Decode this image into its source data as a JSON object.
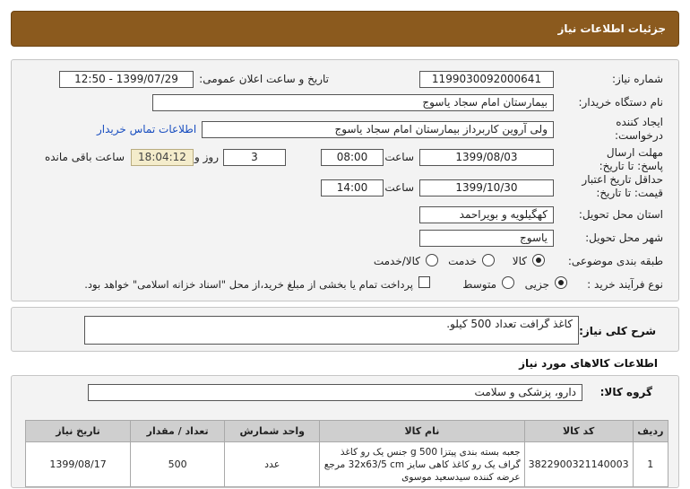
{
  "header": {
    "title": "جزئیات اطلاعات نیاز"
  },
  "form": {
    "need_number_label": "شماره نیاز:",
    "need_number": "1199030092000641",
    "announce_label": "تاریخ و ساعت اعلان عمومی:",
    "announce_value": "1399/07/29 - 12:50",
    "buyer_label": "نام دستگاه خریدار:",
    "buyer_value": "بیمارستان امام سجاد یاسوج",
    "requester_label": "ایجاد کننده درخواست:",
    "requester_value": "ولی آروین کاربرداز بیمارستان امام سجاد یاسوج",
    "contact_link": "اطلاعات تماس خریدار",
    "deadline_label": "مهلت ارسال پاسخ: تا تاریخ:",
    "deadline_date": "1399/08/03",
    "time_label": "ساعت",
    "deadline_time": "08:00",
    "days_value": "3",
    "days_label": "روز و",
    "timer_value": "18:04:12",
    "remaining_label": "ساعت باقی مانده",
    "validity_label": "حداقل تاریخ اعتبار قیمت: تا تاریخ:",
    "validity_date": "1399/10/30",
    "validity_time": "14:00",
    "province_label": "استان محل تحویل:",
    "province_value": "کهگیلویه و بویراحمد",
    "city_label": "شهر محل تحویل:",
    "city_value": "یاسوج",
    "category_label": "طبقه بندی موضوعی:",
    "category_options": [
      "کالا",
      "خدمت",
      "کالا/خدمت"
    ],
    "category_selected": "کالا",
    "process_label": "نوع فرآیند خرید :",
    "process_options": [
      "جزیی",
      "متوسط"
    ],
    "process_selected": "جزیی",
    "payment_note": "پرداخت تمام یا بخشی از مبلغ خرید،از محل \"اسناد خزانه اسلامی\" خواهد بود."
  },
  "summary": {
    "label": "شرح کلی نیاز:",
    "value": "کاغذ گرافت تعداد 500 کیلو."
  },
  "goods_section": {
    "title": "اطلاعات کالاهای مورد نیاز",
    "group_label": "گروه کالا:",
    "group_value": "دارو، پزشکی و سلامت"
  },
  "table": {
    "headers": [
      "ردیف",
      "کد کالا",
      "نام کالا",
      "واحد شمارش",
      "تعداد / مقدار",
      "تاریخ نیاز"
    ],
    "rows": [
      {
        "row": "1",
        "code": "3822900321140003",
        "name": "جعبه بسته بندی پیتزا 500 g جنس یک رو کاغذ گراف یک رو کاغذ کاهی سایز 32x63/5 cm مرجع عرضه کننده سیدسعید موسوی",
        "unit": "عدد",
        "qty": "500",
        "date": "1399/08/17"
      }
    ]
  }
}
